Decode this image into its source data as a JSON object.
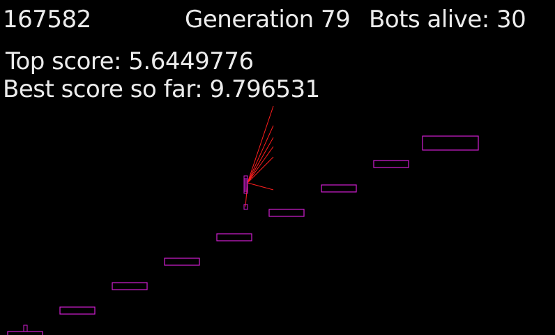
{
  "hud": {
    "frame_counter": "167582",
    "generation": "Generation 79",
    "bots_alive": "Bots alive: 30",
    "top_score": "Top score: 5.6449776",
    "best_score": "Best score so far: 9.796531"
  },
  "colors": {
    "background": "#000000",
    "text": "#ececec",
    "platform": "#d21ed2",
    "bot": "#d21ed2",
    "sensor_ray": "#ff1e1e"
  },
  "scene": {
    "platform_count": 9,
    "bot_group_icon": "bot-stack",
    "sensor_ray_count": 7
  }
}
